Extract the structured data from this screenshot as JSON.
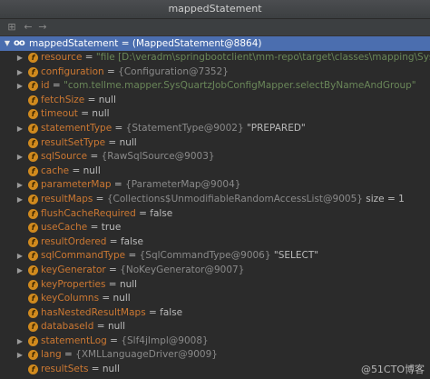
{
  "window": {
    "title": "mappedStatement"
  },
  "root": {
    "name": "mappedStatement",
    "value": "(MappedStatement@8864)"
  },
  "fields": [
    {
      "name": "resource",
      "expandable": true,
      "value": "\"file [D:\\veradm\\springbootclient\\mm-repo\\target\\classes\\mapping\\SysQuartzJobConf",
      "kind": "str"
    },
    {
      "name": "configuration",
      "expandable": true,
      "value": "{Configuration@7352}",
      "kind": "obj"
    },
    {
      "name": "id",
      "expandable": true,
      "value": "\"com.tellme.mapper.SysQuartzJobConfigMapper.selectByNameAndGroup\"",
      "kind": "str"
    },
    {
      "name": "fetchSize",
      "expandable": false,
      "value": "null",
      "kind": "val"
    },
    {
      "name": "timeout",
      "expandable": false,
      "value": "null",
      "kind": "val"
    },
    {
      "name": "statementType",
      "expandable": true,
      "value": "{StatementType@9002}",
      "extra": "\"PREPARED\"",
      "kind": "obj"
    },
    {
      "name": "resultSetType",
      "expandable": false,
      "value": "null",
      "kind": "val"
    },
    {
      "name": "sqlSource",
      "expandable": true,
      "value": "{RawSqlSource@9003}",
      "kind": "obj"
    },
    {
      "name": "cache",
      "expandable": false,
      "value": "null",
      "kind": "val"
    },
    {
      "name": "parameterMap",
      "expandable": true,
      "value": "{ParameterMap@9004}",
      "kind": "obj"
    },
    {
      "name": "resultMaps",
      "expandable": true,
      "value": "{Collections$UnmodifiableRandomAccessList@9005}",
      "extra": "size = 1",
      "kind": "obj"
    },
    {
      "name": "flushCacheRequired",
      "expandable": false,
      "value": "false",
      "kind": "val"
    },
    {
      "name": "useCache",
      "expandable": false,
      "value": "true",
      "kind": "val"
    },
    {
      "name": "resultOrdered",
      "expandable": false,
      "value": "false",
      "kind": "val"
    },
    {
      "name": "sqlCommandType",
      "expandable": true,
      "value": "{SqlCommandType@9006}",
      "extra": "\"SELECT\"",
      "kind": "obj"
    },
    {
      "name": "keyGenerator",
      "expandable": true,
      "value": "{NoKeyGenerator@9007}",
      "kind": "obj"
    },
    {
      "name": "keyProperties",
      "expandable": false,
      "value": "null",
      "kind": "val"
    },
    {
      "name": "keyColumns",
      "expandable": false,
      "value": "null",
      "kind": "val"
    },
    {
      "name": "hasNestedResultMaps",
      "expandable": false,
      "value": "false",
      "kind": "val"
    },
    {
      "name": "databaseId",
      "expandable": false,
      "value": "null",
      "kind": "val"
    },
    {
      "name": "statementLog",
      "expandable": true,
      "value": "{Slf4jImpl@9008}",
      "kind": "obj"
    },
    {
      "name": "lang",
      "expandable": true,
      "value": "{XMLLanguageDriver@9009}",
      "kind": "obj"
    },
    {
      "name": "resultSets",
      "expandable": false,
      "value": "null",
      "kind": "val"
    }
  ],
  "watermark": "@51CTO博客",
  "icons": {
    "field": "field-icon",
    "expand": "expand-arrow-icon",
    "watch": "watch-infinity-icon"
  }
}
